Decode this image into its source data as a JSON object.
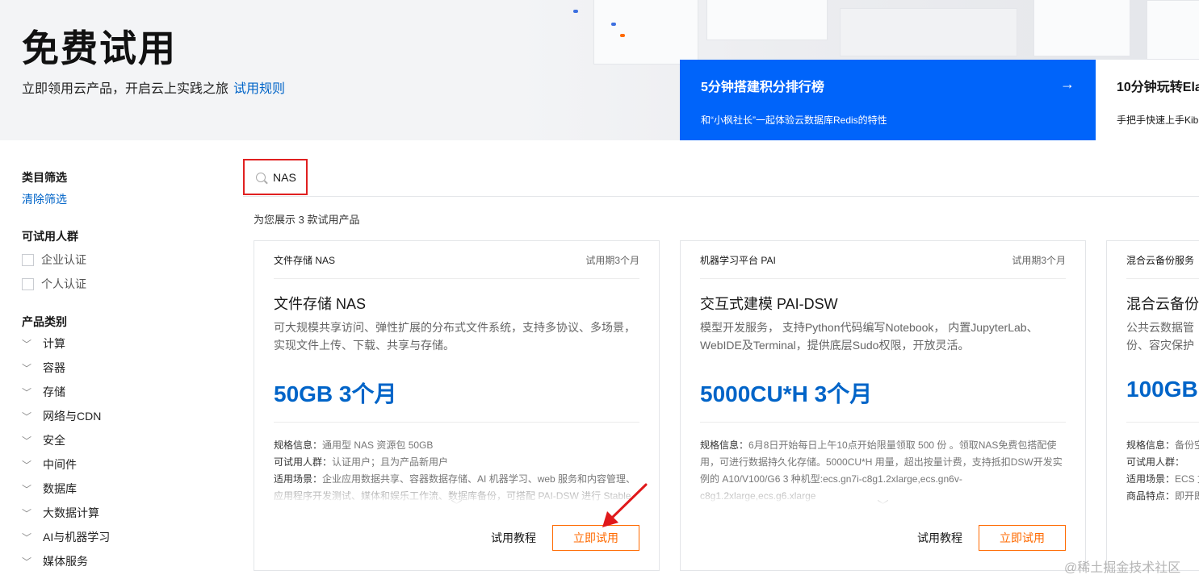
{
  "hero": {
    "title": "免费试用",
    "subtitle": "立即领用云产品，开启云上实践之旅",
    "rules_link": "试用规则"
  },
  "banners": [
    {
      "title": "5分钟搭建积分排行榜",
      "desc": "和“小枫社长”一起体验云数据库Redis的特性"
    },
    {
      "title": "10分钟玩转Ela",
      "desc": "手把手快速上手Kib"
    }
  ],
  "sidebar": {
    "filter_title": "类目筛选",
    "clear_label": "清除筛选",
    "audience_title": "可试用人群",
    "audience_options": [
      "企业认证",
      "个人认证"
    ],
    "category_title": "产品类别",
    "categories": [
      "计算",
      "容器",
      "存储",
      "网络与CDN",
      "安全",
      "中间件",
      "数据库",
      "大数据计算",
      "AI与机器学习",
      "媒体服务"
    ]
  },
  "search": {
    "value": "NAS"
  },
  "result_count": "为您展示 3 款试用产品",
  "cards": [
    {
      "name": "文件存储 NAS",
      "period": "试用期3个月",
      "title": "文件存储 NAS",
      "desc": "可大规模共享访问、弹性扩展的分布式文件系统，支持多协议、多场景，实现文件上传、下载、共享与存储。",
      "quota": "50GB 3个月",
      "specs": [
        {
          "k": "规格信息：",
          "v": "通用型 NAS 资源包 50GB"
        },
        {
          "k": "可试用人群：",
          "v": "认证用户；且为产品新用户"
        },
        {
          "k": "适用场景：",
          "v": "企业应用数据共享、容器数据存储、AI 机器学习、web 服务和内容管理、应用程序开发测试、媒体和娱乐工作流、数据库备份，可搭配 PAI-DSW 进行 Stable"
        }
      ],
      "tutorial": "试用教程",
      "try": "立即试用"
    },
    {
      "name": "机器学习平台 PAI",
      "period": "试用期3个月",
      "title": "交互式建模 PAI-DSW",
      "desc": "模型开发服务， 支持Python代码编写Notebook， 内置JupyterLab、WebIDE及Terminal，提供底层Sudo权限，开放灵活。",
      "quota": "5000CU*H 3个月",
      "specs": [
        {
          "k": "规格信息：",
          "v": "6月8日开始每日上午10点开始限量领取 500 份 。领取NAS免费包搭配使用，可进行数据持久化存储。5000CU*H 用量，超出按量计费，支持抵扣DSW开发实例的 A10/V100/G6 3 种机型:ecs.gn7i-c8g1.2xlarge,ecs.gn6v-c8g1.2xlarge,ecs.g6.xlarge"
        }
      ],
      "tutorial": "试用教程",
      "try": "立即试用"
    },
    {
      "name": "混合云备份服务",
      "period": "",
      "title": "混合云备份",
      "desc": "公共云数据管份、容灾保护以",
      "quota": "100GB",
      "specs": [
        {
          "k": "规格信息：",
          "v": "备份空"
        },
        {
          "k": "可试用人群：",
          "v": ""
        },
        {
          "k": "适用场景：",
          "v": "ECS 文"
        },
        {
          "k": "商品特点：",
          "v": "即开即"
        }
      ],
      "tutorial": "",
      "try": ""
    }
  ],
  "watermark": "@稀土掘金技术社区"
}
